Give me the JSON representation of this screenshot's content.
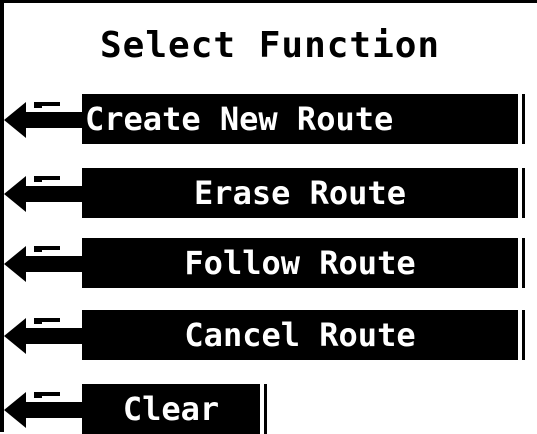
{
  "screen": {
    "title": "Select Function"
  },
  "menu": {
    "items": [
      {
        "label": "Create New Route",
        "icon": "enter-arrow-icon"
      },
      {
        "label": "Erase Route",
        "icon": "enter-arrow-icon"
      },
      {
        "label": "Follow Route",
        "icon": "enter-arrow-icon"
      },
      {
        "label": "Cancel Route",
        "icon": "enter-arrow-icon"
      },
      {
        "label": "Clear",
        "icon": "enter-arrow-icon"
      }
    ]
  },
  "colors": {
    "background": "#ffffff",
    "bar": "#000000",
    "text_on_bar": "#ffffff"
  }
}
